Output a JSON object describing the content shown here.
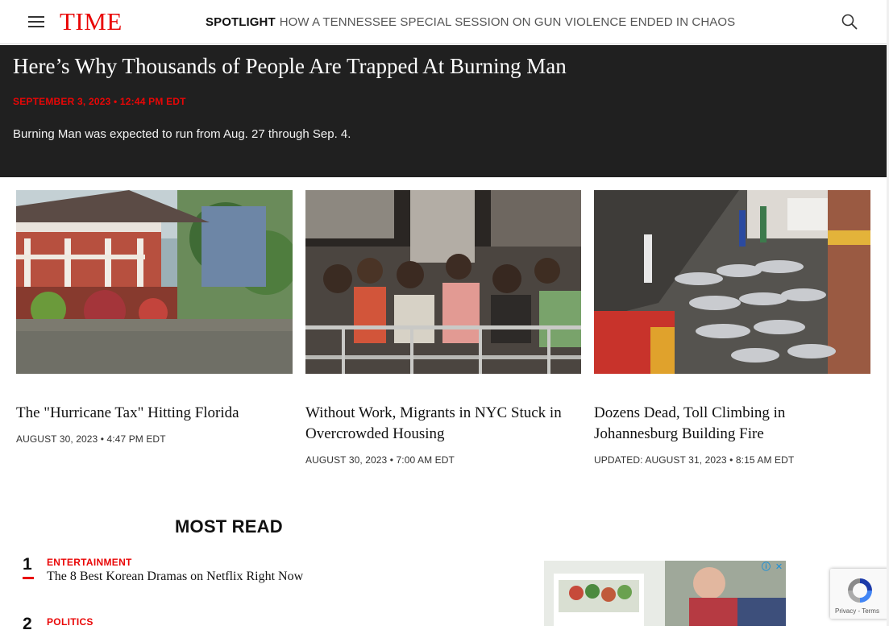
{
  "header": {
    "logo": "TIME",
    "spotlight_label": "SPOTLIGHT",
    "spotlight_text": "HOW A TENNESSEE SPECIAL SESSION ON GUN VIOLENCE ENDED IN CHAOS"
  },
  "hero": {
    "title": "Here’s Why Thousands of People Are Trapped At Burning Man",
    "date": "SEPTEMBER 3, 2023 • 12:44 PM EDT",
    "description": "Burning Man was expected to run from Aug. 27 through Sep. 4."
  },
  "cards": [
    {
      "title": "The \"Hurricane Tax\" Hitting Florida",
      "date": "AUGUST 30, 2023 • 4:47 PM EDT"
    },
    {
      "title": "Without Work, Migrants in NYC Stuck in Overcrowded Housing",
      "date": "AUGUST 30, 2023 • 7:00 AM EDT"
    },
    {
      "title": "Dozens Dead, Toll Climbing in Johannesburg Building Fire",
      "date": "UPDATED: AUGUST 31, 2023 • 8:15 AM EDT"
    }
  ],
  "most_read": {
    "heading": "MOST READ",
    "items": [
      {
        "number": "1",
        "category": "ENTERTAINMENT",
        "title": "The 8 Best Korean Dramas on Netflix Right Now"
      },
      {
        "number": "2",
        "category": "POLITICS",
        "title": ""
      }
    ]
  },
  "recaptcha": {
    "links": "Privacy - Terms"
  },
  "colors": {
    "brand_red": "#e90606",
    "hero_bg": "#202020"
  },
  "icons": [
    "menu-icon",
    "search-icon",
    "adchoices-icon",
    "close-icon",
    "recaptcha-icon"
  ]
}
